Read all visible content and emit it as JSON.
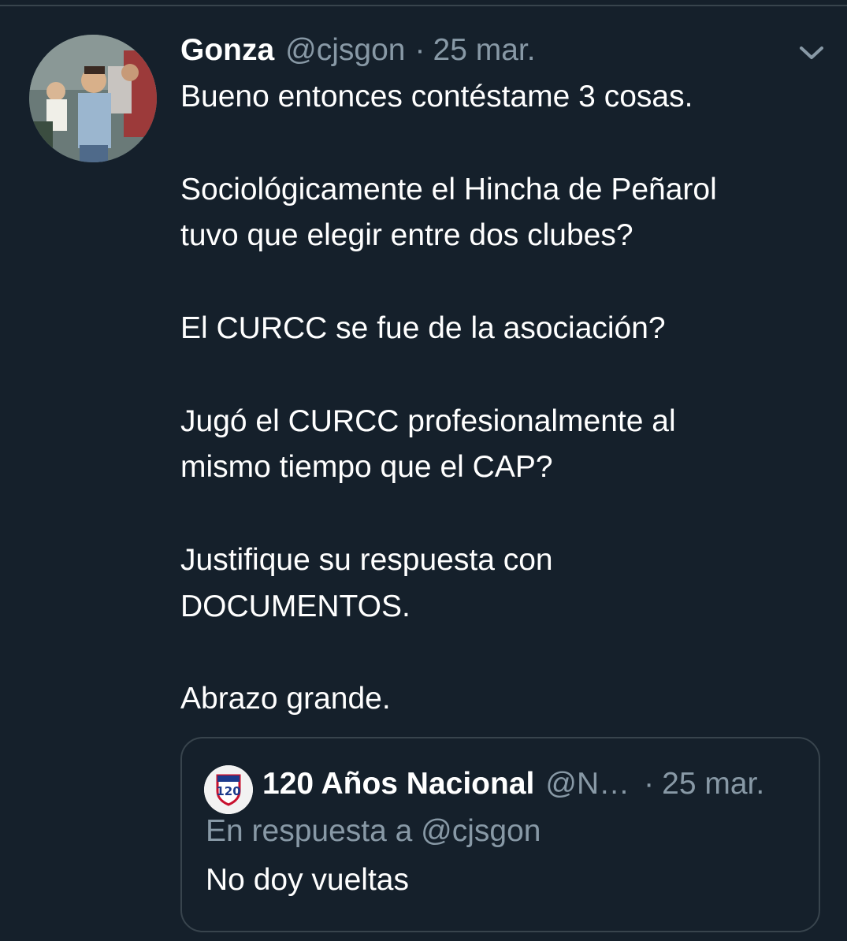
{
  "tweet": {
    "author_name": "Gonza",
    "author_handle": "@cjsgon",
    "separator": "·",
    "timestamp": "25 mar.",
    "text": "Bueno entonces contéstame 3 cosas.\n\nSociológicamente el Hincha de Peñarol\ntuvo que elegir entre dos clubes?\n\nEl CURCC se fue de la asociación?\n\nJugó el CURCC profesionalmente al\nmismo tiempo que el CAP?\n\nJustifique su respuesta con\nDOCUMENTOS.\n\nAbrazo grande.",
    "menu_icon": "chevron-down-icon"
  },
  "quoted_tweet": {
    "author_name": "120 Años Nacional",
    "author_handle": "@N…",
    "separator": "·",
    "timestamp": "25 mar.",
    "reply_context": "En respuesta a @cjsgon",
    "text": "No doy vueltas",
    "avatar_text": "120"
  },
  "colors": {
    "background": "#15202b",
    "text_primary": "#ffffff",
    "text_secondary": "#8899a6",
    "border": "#38444d"
  }
}
